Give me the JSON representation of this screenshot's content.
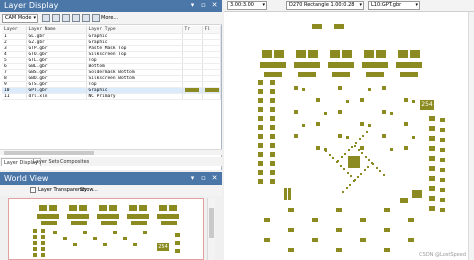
{
  "layer_display": {
    "title": "Layer Display",
    "mode_select": "CAM Mode",
    "more_label": "More...",
    "columns": [
      "Layer",
      "Layer Name",
      "Layer Type",
      "Tr",
      "Fl"
    ],
    "rows": [
      {
        "num": "1",
        "name": "GL.gbr",
        "type": "Graphic",
        "swatch": false
      },
      {
        "num": "2",
        "name": "G2.gbr",
        "type": "Graphic",
        "swatch": false
      },
      {
        "num": "3",
        "name": "GTP.gbr",
        "type": "Paste Mask Top",
        "swatch": false
      },
      {
        "num": "4",
        "name": "GTO.gbr",
        "type": "Silkscreen Top",
        "swatch": false
      },
      {
        "num": "5",
        "name": "GTL.gbr",
        "type": "Top",
        "swatch": false
      },
      {
        "num": "6",
        "name": "GBL.gbr",
        "type": "Bottom",
        "swatch": false
      },
      {
        "num": "7",
        "name": "GBS.gbr",
        "type": "Soldermask Bottom",
        "swatch": false
      },
      {
        "num": "8",
        "name": "GBO.gbr",
        "type": "Silkscreen Bottom",
        "swatch": false
      },
      {
        "num": "9",
        "name": "GTS.gbr",
        "type": "Top",
        "swatch": false
      },
      {
        "num": "10",
        "name": "GPT.gbr",
        "type": "Graphic",
        "swatch": true
      },
      {
        "num": "11",
        "name": "drl.xln",
        "type": "NC Primary",
        "swatch": false
      }
    ],
    "tabs": [
      "Layer Display",
      "Layer Sets",
      "Composites"
    ]
  },
  "world_view": {
    "title": "World View",
    "transparency_label": "Layer Transparency",
    "show_label": "Show...",
    "label_text": "254"
  },
  "cam_toolbar": {
    "zoom": "3.00:3.00",
    "aperture": "D270  Rectangle 1.00:0.28",
    "layer": "L10:GPT.gbr"
  },
  "canvas": {
    "label_text": "254",
    "watermark": "CSDN @LostSpeed"
  },
  "colors": {
    "pad": "#8b8b21",
    "title_bar": "#4a76a8",
    "selection": "#dcebfb"
  }
}
